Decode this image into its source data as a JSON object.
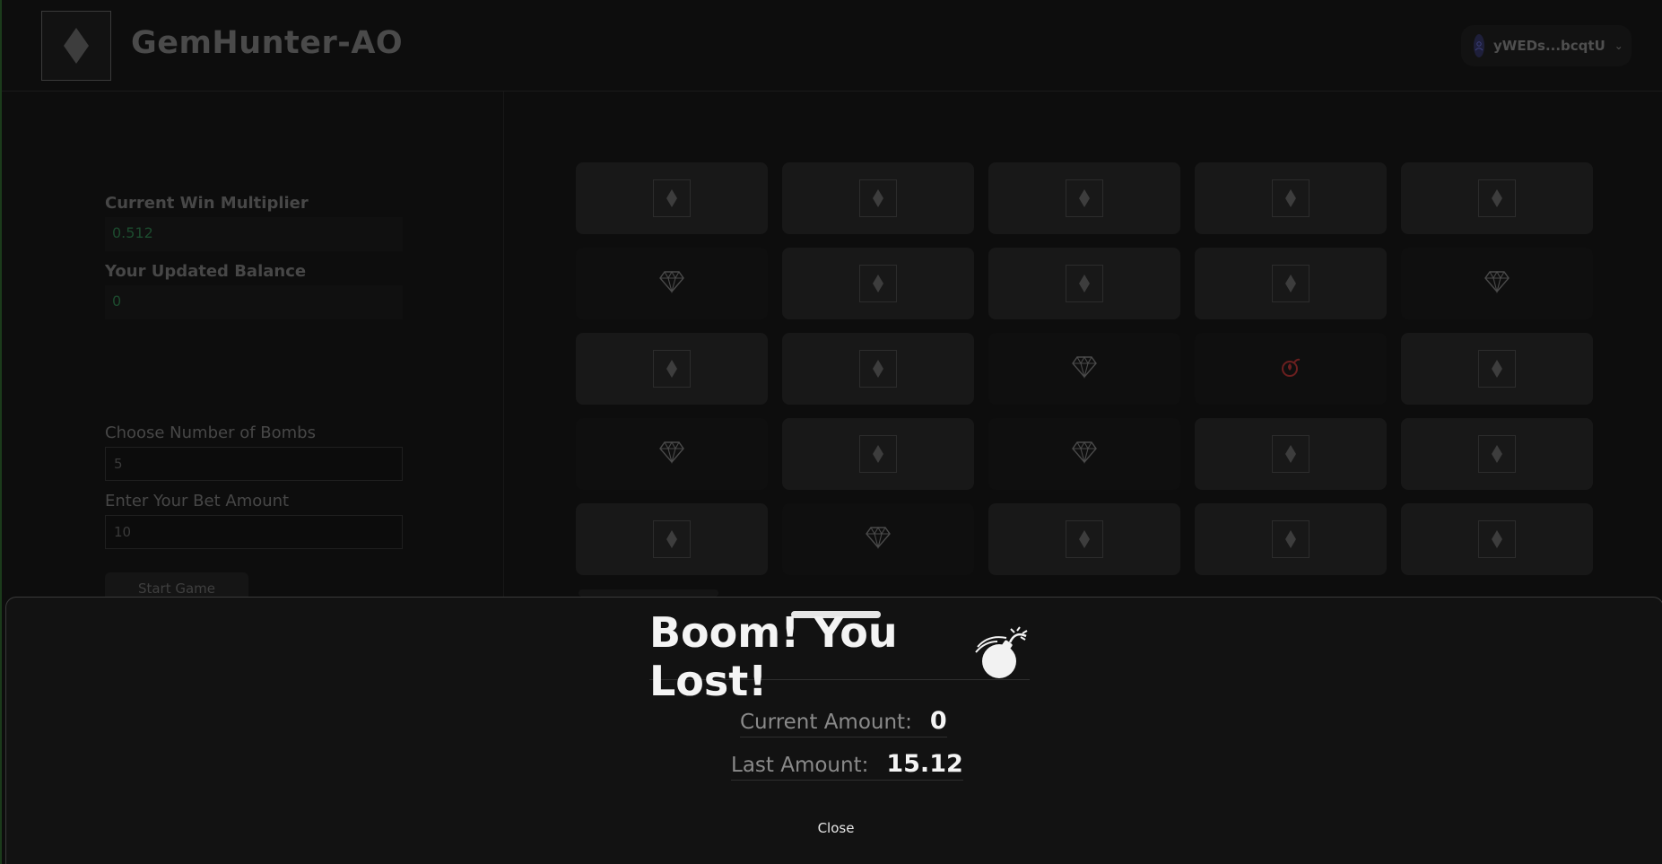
{
  "header": {
    "title": "GemHunter-AO",
    "wallet_address": "yWEDs...bcqtU"
  },
  "left_panel": {
    "multiplier_label": "Current Win Multiplier",
    "multiplier_value": "0.512",
    "balance_label": "Your Updated Balance",
    "balance_value": "0",
    "bombs_label": "Choose Number of Bombs",
    "bombs_value": "5",
    "bet_label": "Enter Your Bet Amount",
    "bet_value": "10",
    "start_button": "Start Game"
  },
  "grid": {
    "rows": 5,
    "cols": 5,
    "tiles": [
      "hidden",
      "hidden",
      "hidden",
      "hidden",
      "hidden",
      "gem",
      "hidden",
      "hidden",
      "hidden",
      "gem",
      "hidden",
      "hidden",
      "gem",
      "bomb",
      "hidden",
      "gem",
      "hidden",
      "gem",
      "hidden",
      "hidden",
      "hidden",
      "gem",
      "hidden",
      "hidden",
      "hidden"
    ]
  },
  "modal": {
    "title": "Boom! You Lost!",
    "current_amount_label": "Current Amount:",
    "current_amount_value": "0",
    "last_amount_label": "Last Amount:",
    "last_amount_value": "15.12",
    "close_label": "Close"
  },
  "icons": {
    "logo": "diamond-icon",
    "hidden_tile": "diamond-icon",
    "gem_tile": "gem-icon",
    "bomb_tile": "flame-bomb-icon",
    "modal_icon": "bomb-icon",
    "wallet_avatar": "user-icon"
  },
  "colors": {
    "gain_text": "#1c4b2e",
    "bomb": "#6b1f1f",
    "modal_bg": "#121212"
  }
}
